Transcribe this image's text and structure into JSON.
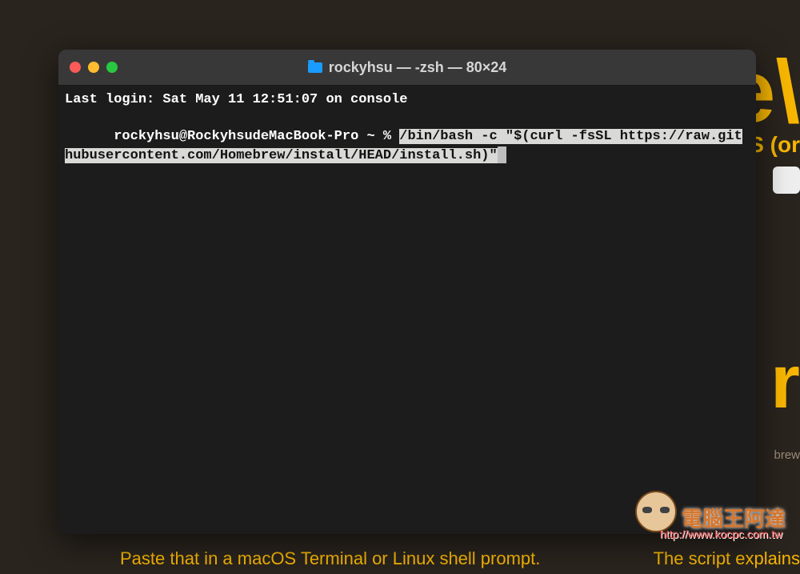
{
  "background": {
    "headline_frag1": "e\\",
    "sub_frag": "S (or",
    "headline_frag2": "r",
    "code_frag": "brew",
    "instruction": "Paste that in a macOS Terminal or Linux shell prompt.",
    "instruction2": "The script explains"
  },
  "terminal": {
    "title": "rockyhsu — -zsh — 80×24",
    "last_login": "Last login: Sat May 11 12:51:07 on console",
    "prompt": "rockyhsu@RockyhsudeMacBook-Pro ~ % ",
    "command": "/bin/bash -c \"$(curl -fsSL https://raw.githubusercontent.com/Homebrew/install/HEAD/install.sh)\""
  },
  "watermark": {
    "text": "電腦王阿達",
    "url": "http://www.kocpc.com.tw"
  }
}
